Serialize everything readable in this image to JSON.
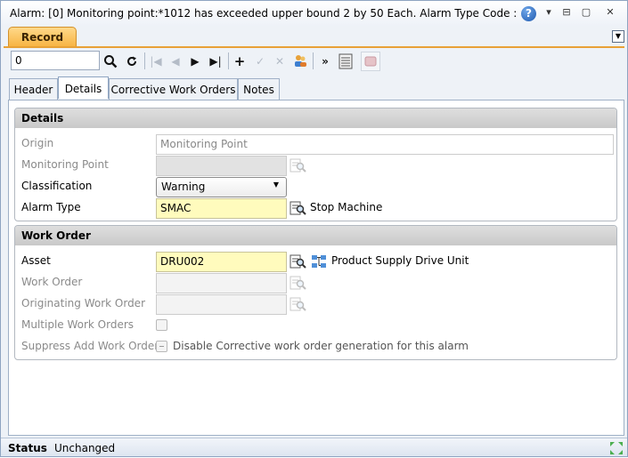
{
  "window": {
    "title": "Alarm: [0] Monitoring point:*1012 has exceeded upper bound 2 by 50 Each. Alarm Type Code : SMAC i",
    "help_glyph": "?",
    "menu_glyph": "▾",
    "restore_glyph": "⊟",
    "maximize_glyph": "▢",
    "close_glyph": "✕"
  },
  "record_tab": {
    "label": "Record",
    "collapse_glyph": "▼"
  },
  "toolbar": {
    "record_value": "0",
    "icons": [
      "search-icon",
      "refresh-icon",
      "first-record-icon",
      "previous-record-icon",
      "next-record-icon",
      "last-record-icon",
      "add-icon",
      "save-icon",
      "cancel-icon",
      "users-icon",
      "more-icon",
      "list-icon",
      "report-icon"
    ]
  },
  "tabs": [
    {
      "label": "Header",
      "active": false
    },
    {
      "label": "Details",
      "active": true
    },
    {
      "label": "Corrective Work Orders",
      "active": false
    },
    {
      "label": "Notes",
      "active": false
    }
  ],
  "details_section": {
    "title": "Details",
    "origin": {
      "label": "Origin",
      "value": "Monitoring Point"
    },
    "monitoring_point": {
      "label": "Monitoring Point",
      "value": ""
    },
    "classification": {
      "label": "Classification",
      "value": "Warning"
    },
    "alarm_type": {
      "label": "Alarm Type",
      "value": "SMAC",
      "description": "Stop Machine"
    }
  },
  "work_order_section": {
    "title": "Work Order",
    "asset": {
      "label": "Asset",
      "value": "DRU002",
      "description": "Product Supply Drive Unit"
    },
    "work_order": {
      "label": "Work Order",
      "value": ""
    },
    "originating_work_order": {
      "label": "Originating Work Order",
      "value": ""
    },
    "multiple_work_orders": {
      "label": "Multiple Work Orders",
      "checked": false
    },
    "suppress_add_work_order": {
      "label": "Suppress Add Work Order",
      "text": "Disable Corrective work order generation for this alarm"
    }
  },
  "status": {
    "label": "Status",
    "value": "Unchanged"
  },
  "colors": {
    "accent": "#f7b341",
    "required_field": "#fffbbd",
    "section_header": "#d4d4d4",
    "frame": "#8ea4c1"
  }
}
